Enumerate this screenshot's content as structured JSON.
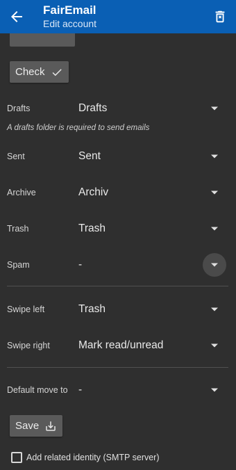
{
  "appbar": {
    "title": "FairEmail",
    "subtitle": "Edit account",
    "color": "#0a5fb4"
  },
  "buttons": {
    "check_label": "Check",
    "save_label": "Save"
  },
  "folders": {
    "drafts": {
      "label": "Drafts",
      "value": "Drafts"
    },
    "drafts_hint": "A drafts folder is required to send emails",
    "sent": {
      "label": "Sent",
      "value": "Sent"
    },
    "archive": {
      "label": "Archive",
      "value": "Archiv"
    },
    "trash": {
      "label": "Trash",
      "value": "Trash"
    },
    "spam": {
      "label": "Spam",
      "value": "-"
    }
  },
  "swipe": {
    "left": {
      "label": "Swipe left",
      "value": "Trash"
    },
    "right": {
      "label": "Swipe right",
      "value": "Mark read/unread"
    }
  },
  "move": {
    "default": {
      "label": "Default move to",
      "value": "-"
    }
  },
  "identity": {
    "label": "Add related identity (SMTP server)",
    "checked": false
  }
}
